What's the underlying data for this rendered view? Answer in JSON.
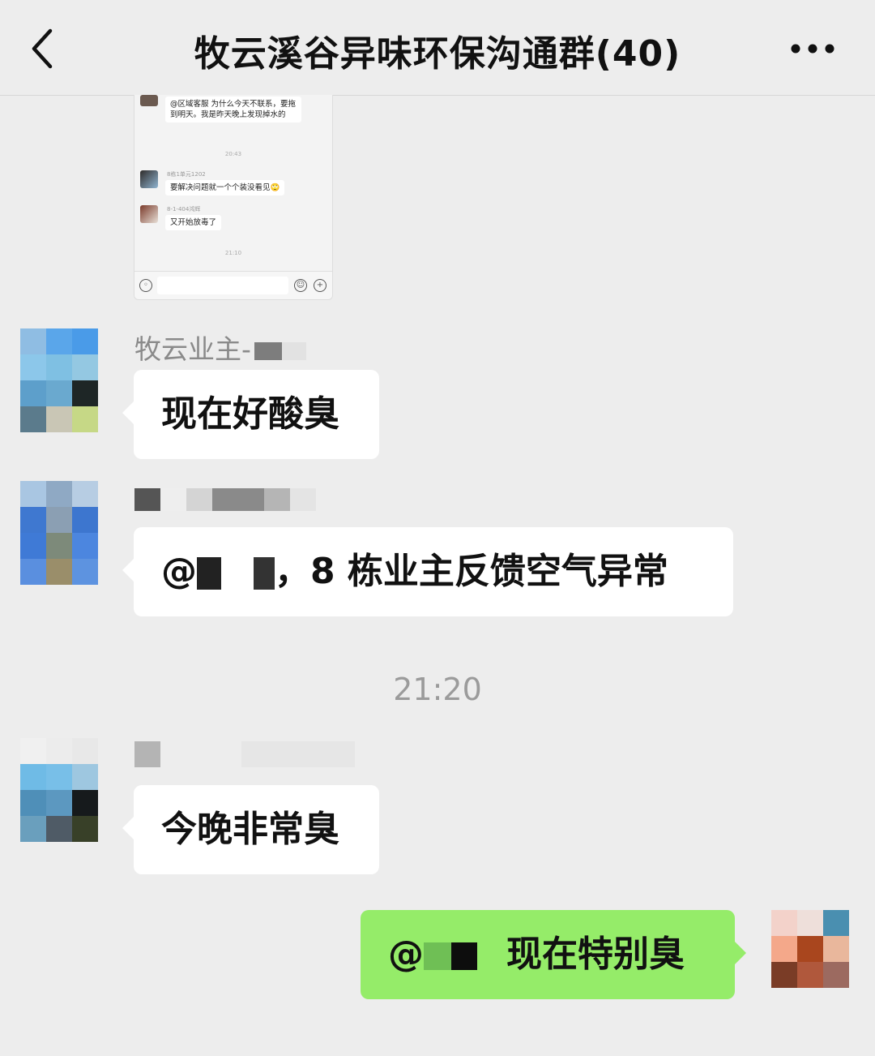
{
  "header": {
    "title": "牧云溪谷异味环保沟通群(40)",
    "back_icon": "chevron-left-icon",
    "more_icon": "more-dots-icon"
  },
  "quoted_screenshot": {
    "msg1": "@区域客服  为什么今天不联系，要拖到明天。我是昨天晚上发现掉水的",
    "time1": "20:43",
    "name2": "8栋1单元1202",
    "msg2": "要解决问题就一个个装没看见🙄",
    "name3": "8-1-404鸿辉",
    "msg3": "又开始放毒了",
    "time2": "21:10"
  },
  "messages": [
    {
      "sender": "牧云业主-",
      "text": "现在好酸臭"
    },
    {
      "sender": "",
      "text_prefix": "@",
      "text": "，8 栋业主反馈空气异常"
    },
    {
      "sender": "",
      "text": "今晚非常臭"
    },
    {
      "text_prefix": "@",
      "text": "现在特别臭"
    }
  ],
  "timestamp": "21:20",
  "colors": {
    "background": "#ededed",
    "bubble_other": "#ffffff",
    "bubble_self": "#95ec69",
    "sender_text": "#8a8a8a"
  }
}
